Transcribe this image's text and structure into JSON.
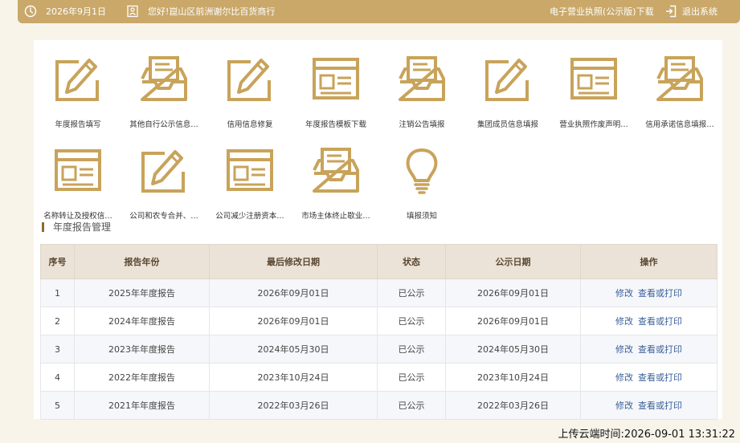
{
  "topbar": {
    "date": "2026年9月1日",
    "greeting": "您好!崑山区前洲谢尔比百货商行",
    "download_label": "电子营业执照(公示版)下载",
    "logout_label": "退出系统"
  },
  "colors": {
    "accent": "#c9a869",
    "icon": "#c8a35a",
    "link": "#3b5f99"
  },
  "tiles": [
    {
      "label": "年度报告填写",
      "icon": "edit-form-icon"
    },
    {
      "label": "其他自行公示信息…",
      "icon": "inbox-tray-icon"
    },
    {
      "label": "信用信息修复",
      "icon": "edit-form-icon"
    },
    {
      "label": "年度报告模板下载",
      "icon": "browser-form-icon"
    },
    {
      "label": "注销公告填报",
      "icon": "inbox-tray-icon"
    },
    {
      "label": "集团成员信息填报",
      "icon": "edit-form-icon"
    },
    {
      "label": "营业执照作废声明…",
      "icon": "browser-form-icon"
    },
    {
      "label": "信用承诺信息填报…",
      "icon": "inbox-tray-icon"
    },
    {
      "label": "名称转让及授权信…",
      "icon": "browser-form-icon"
    },
    {
      "label": "公司和农专合并、…",
      "icon": "edit-form-icon"
    },
    {
      "label": "公司减少注册资本…",
      "icon": "browser-form-icon"
    },
    {
      "label": "市场主体终止歇业…",
      "icon": "inbox-tray-icon"
    },
    {
      "label": "填报须知",
      "icon": "lightbulb-icon"
    }
  ],
  "section": {
    "title": "年度报告管理"
  },
  "table": {
    "headers": [
      "序号",
      "报告年份",
      "最后修改日期",
      "状态",
      "公示日期",
      "操作"
    ],
    "rows": [
      {
        "no": "1",
        "year": "2025年年度报告",
        "modified": "2026年09月01日",
        "status": "已公示",
        "published": "2026年09月01日"
      },
      {
        "no": "2",
        "year": "2024年年度报告",
        "modified": "2026年09月01日",
        "status": "已公示",
        "published": "2026年09月01日"
      },
      {
        "no": "3",
        "year": "2023年年度报告",
        "modified": "2024年05月30日",
        "status": "已公示",
        "published": "2024年05月30日"
      },
      {
        "no": "4",
        "year": "2022年年度报告",
        "modified": "2023年10月24日",
        "status": "已公示",
        "published": "2023年10月24日"
      },
      {
        "no": "5",
        "year": "2021年年度报告",
        "modified": "2022年03月26日",
        "status": "已公示",
        "published": "2022年03月26日"
      }
    ],
    "edit_label": "修改",
    "view_label": "查看或打印"
  },
  "footer": {
    "upload_time": "上传云端时间:2026-09-01 13:31:22"
  }
}
